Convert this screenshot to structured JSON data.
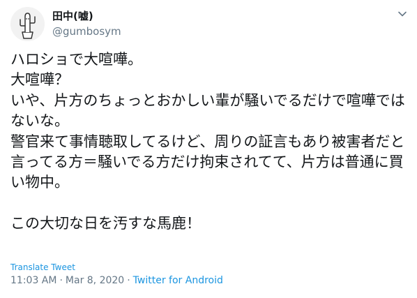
{
  "user": {
    "display_name": "田中(嘘)",
    "handle": "@gumbosym",
    "avatar": "cactus-drawing-icon"
  },
  "menu": {
    "icon": "chevron-down-icon"
  },
  "tweet": {
    "text": "ハロショで大喧嘩。\n大喧嘩？\nいや、片方のちょっとおかしい輩が騒いでるだけで喧嘩ではないな。\n警官来て事情聴取してるけど、周りの証言もあり被害者だと言ってる方＝騒いでる方だけ拘束されてて、片方は普通に買い物中。\n\nこの大切な日を汚すな馬鹿！",
    "translate_label": "Translate Tweet",
    "time": "11:03 AM",
    "date": "Mar 8, 2020",
    "separator": "·",
    "source": "Twitter for Android"
  },
  "colors": {
    "text": "#14171a",
    "secondary": "#657786",
    "link": "#1b95e0"
  }
}
